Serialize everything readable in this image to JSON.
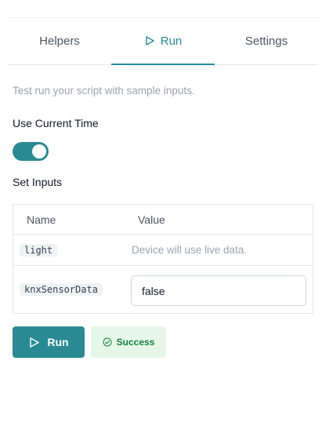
{
  "tabs": [
    {
      "label": "Helpers"
    },
    {
      "label": "Run",
      "active": true,
      "icon": "play-outline-icon"
    },
    {
      "label": "Settings"
    }
  ],
  "description": "Test run your script with sample inputs.",
  "use_current_time": {
    "label": "Use Current Time",
    "enabled": true
  },
  "set_inputs": {
    "label": "Set Inputs",
    "columns": [
      "Name",
      "Value"
    ],
    "rows": [
      {
        "name": "light",
        "value_text": "Device will use live data."
      },
      {
        "name": "knxSensorData",
        "value": "false"
      }
    ]
  },
  "run_button": {
    "label": "Run",
    "icon": "play-outline-icon"
  },
  "status": {
    "label": "Success",
    "icon": "check-circle-icon"
  },
  "colors": {
    "accent": "#2a8a93",
    "success_bg": "#e6f7ea",
    "success_text": "#15803d"
  }
}
